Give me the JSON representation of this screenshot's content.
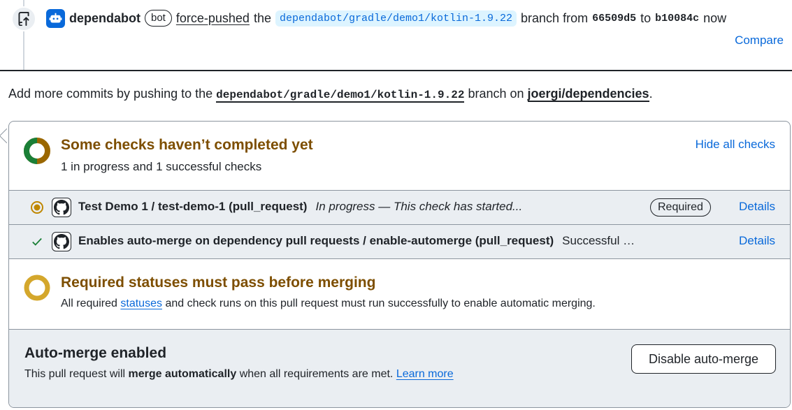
{
  "event": {
    "actor": "dependabot",
    "bot_badge": "bot",
    "action": "force-pushed",
    "the": "the",
    "branch": "dependabot/gradle/demo1/kotlin-1.9.22",
    "branch_word": "branch from",
    "from_sha": "66509d5",
    "to_word": "to",
    "to_sha": "b10084c",
    "time": "now",
    "compare_label": "Compare",
    "icon": "repo-push-icon"
  },
  "hint": {
    "prefix": "Add more commits by pushing to the",
    "branch": "dependabot/gradle/demo1/kotlin-1.9.22",
    "middle": "branch on",
    "repo": "joergi/dependencies",
    "suffix": "."
  },
  "checks": {
    "title": "Some checks haven’t completed yet",
    "subtitle": "1 in progress and 1 successful checks",
    "hide_label": "Hide all checks",
    "rows": [
      {
        "name": "Test Demo 1 / test-demo-1 (pull_request)",
        "status": "In progress — This check has started...",
        "badge": "Required",
        "details": "Details",
        "state": "in-progress"
      },
      {
        "name": "Enables auto-merge on dependency pull requests / enable-automerge (pull_request)",
        "status": "Successful …",
        "details": "Details",
        "state": "success"
      }
    ]
  },
  "required": {
    "title": "Required statuses must pass before merging",
    "text_before": "All required",
    "link": "statuses",
    "text_after": "and check runs on this pull request must run successfully to enable automatic merging."
  },
  "automerge": {
    "title": "Auto-merge enabled",
    "text_before": "This pull request will",
    "text_bold": "merge automatically",
    "text_after": "when all requirements are met.",
    "learn_more": "Learn more",
    "button": "Disable auto-merge"
  },
  "colors": {
    "accent": "#0969da",
    "attention": "#7d4e00",
    "success": "#1a7f37",
    "pending": "#bf8700"
  }
}
